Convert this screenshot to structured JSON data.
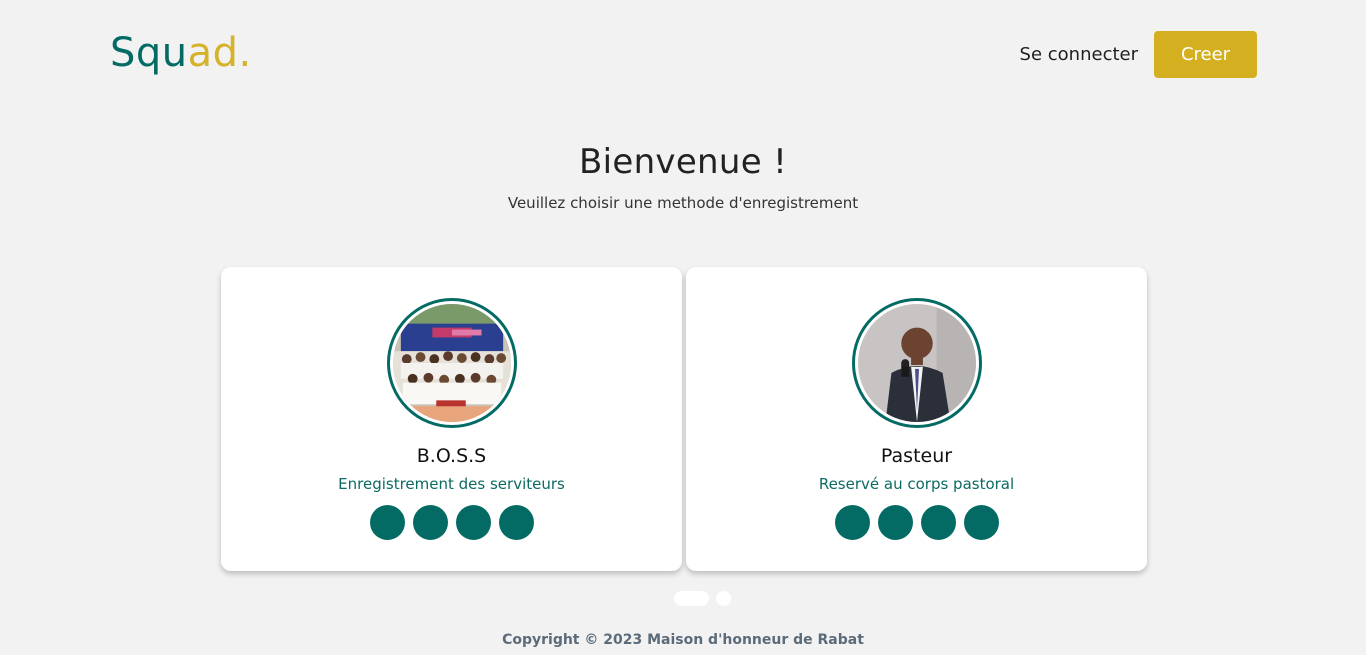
{
  "header": {
    "logo_part1": "Squ",
    "logo_part2": "ad.",
    "login_label": "Se connecter",
    "create_label": "Creer"
  },
  "hero": {
    "title": "Bienvenue !",
    "subtitle": "Veuillez choisir une methode d'enregistrement"
  },
  "cards": [
    {
      "title": "B.O.S.S",
      "subtitle": "Enregistrement des serviteurs",
      "image": "group-photo"
    },
    {
      "title": "Pasteur",
      "subtitle": "Reservé au corps pastoral",
      "image": "pastor-photo"
    }
  ],
  "carousel": {
    "total": 2,
    "active": 1
  },
  "footer": {
    "copyright": "Copyright © 2023 Maison d'honneur de Rabat"
  },
  "colors": {
    "primary": "#046b64",
    "accent": "#d4b021",
    "background": "#f2f2f2"
  }
}
